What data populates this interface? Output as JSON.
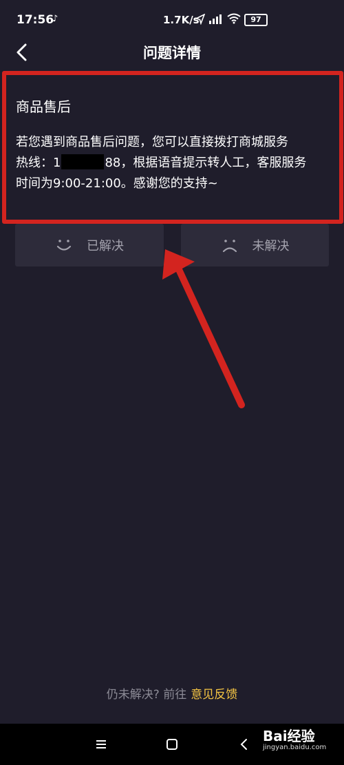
{
  "status_bar": {
    "time": "17:56",
    "tiktok_glyph": "♪",
    "network_speed": "1.7K/s",
    "battery": "97"
  },
  "header": {
    "title": "问题详情"
  },
  "answer": {
    "title": "商品售后",
    "body_line1": "若您遇到商品售后问题，您可以直接拨打商城服务",
    "hotline_prefix": "热线：1",
    "hotline_suffix": "88，根据语音提示转人工，客服服务",
    "body_line3": "时间为9:00-21:00。感谢您的支持~"
  },
  "feedback": {
    "solved_label": "已解决",
    "unsolved_label": "未解决"
  },
  "footer": {
    "prompt": "仍未解决? 前往",
    "link": "意见反馈"
  },
  "watermark": {
    "brand": "Bai经验",
    "url": "jingyan.baidu.com"
  },
  "colors": {
    "background": "#1f1d2b",
    "button_bg": "#2d2b3a",
    "highlight_red": "#d3241f",
    "link_yellow": "#f5c543"
  }
}
